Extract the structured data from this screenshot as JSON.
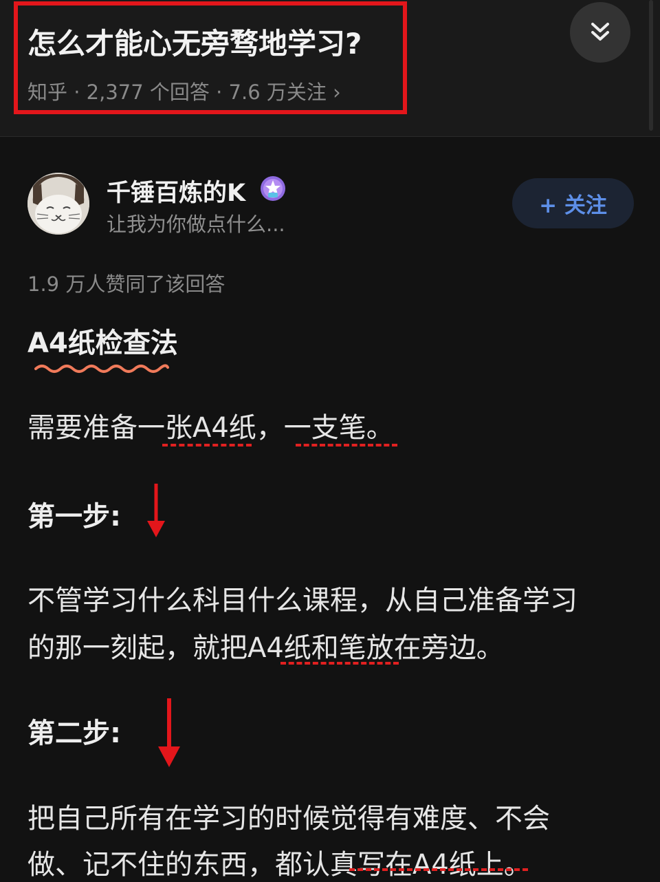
{
  "question": {
    "title": "怎么才能心无旁骛地学习?",
    "meta": "知乎 · 2,377 个回答 · 7.6 万关注 ›"
  },
  "author": {
    "name": "千锤百炼的K",
    "bio": "让我为你做点什么...",
    "follow_label": "+ 关注"
  },
  "answer": {
    "upvotes": "1.9 万人赞同了该回答",
    "heading": "A4纸检查法",
    "line1": "需要准备一张A4纸，一支笔。",
    "step1_label": "第一步:",
    "step1_line1": "不管学习什么科目什么课程，从自己准备学习",
    "step1_line2": "的那一刻起，就把A4纸和笔放在旁边。",
    "step2_label": "第二步:",
    "step2_line1": "把自己所有在学习的时候觉得有难度、不会",
    "step2_line2": "做、记不住的东西，都认真写在A4纸上。"
  },
  "icons": {
    "collapse": "chevron-double-down-icon",
    "avatar": "cartoon-cat-avatar",
    "badge": "star-badge-icon",
    "arrow": "red-down-arrow"
  },
  "colors": {
    "background": "#121212",
    "highlight": "#e3161b",
    "follow_text": "#5d8fe8",
    "underline_wave": "#f07a5a",
    "dash_red": "#e02020"
  }
}
